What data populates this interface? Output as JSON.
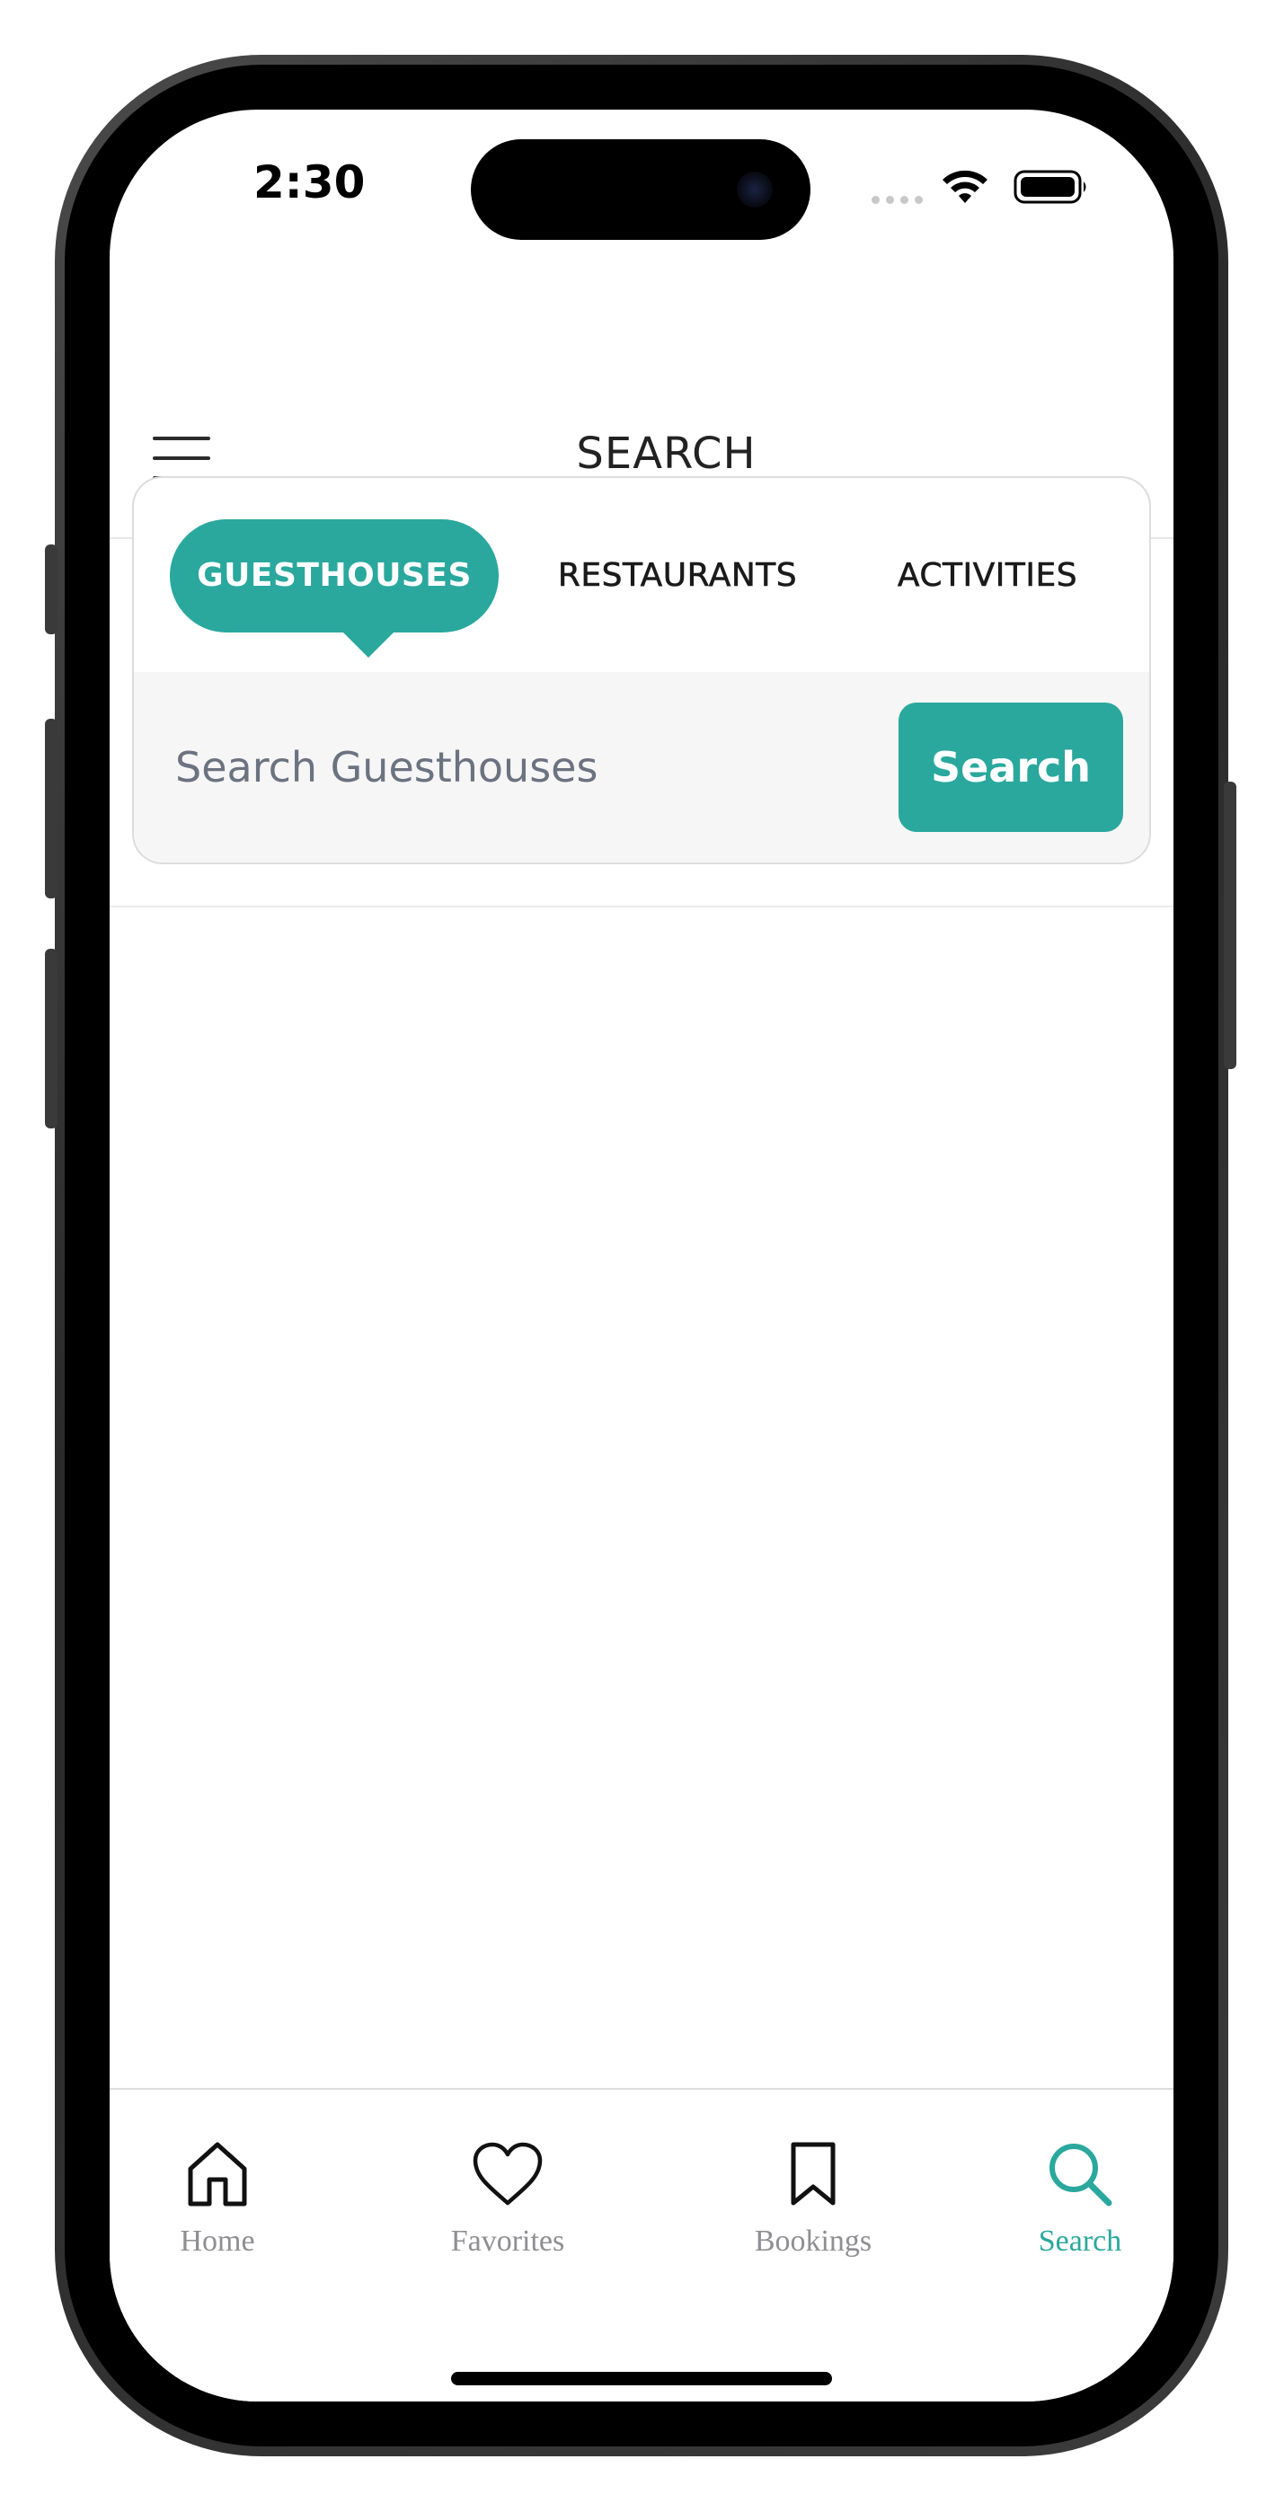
{
  "status_bar": {
    "time": "2:30",
    "icons": [
      "signal-dots-icon",
      "wifi-icon",
      "battery-icon"
    ]
  },
  "header": {
    "title": "SEARCH",
    "menu_icon": "hamburger-menu-icon"
  },
  "search": {
    "tabs": [
      {
        "label": "GUESTHOUSES",
        "active": true
      },
      {
        "label": "RESTAURANTS",
        "active": false
      },
      {
        "label": "ACTIVITIES",
        "active": false
      }
    ],
    "placeholder": "Search Guesthouses",
    "value": "",
    "button_label": "Search"
  },
  "bottom_nav": {
    "items": [
      {
        "label": "Home",
        "icon": "home-icon",
        "active": false
      },
      {
        "label": "Favorites",
        "icon": "heart-icon",
        "active": false
      },
      {
        "label": "Bookings",
        "icon": "bookmark-icon",
        "active": false
      },
      {
        "label": "Search",
        "icon": "search-icon",
        "active": true
      }
    ]
  },
  "colors": {
    "accent": "#2aa89d",
    "inactive_nav": "#8e8e93",
    "title_text": "#222222",
    "search_row_bg": "#f6f6f6"
  }
}
